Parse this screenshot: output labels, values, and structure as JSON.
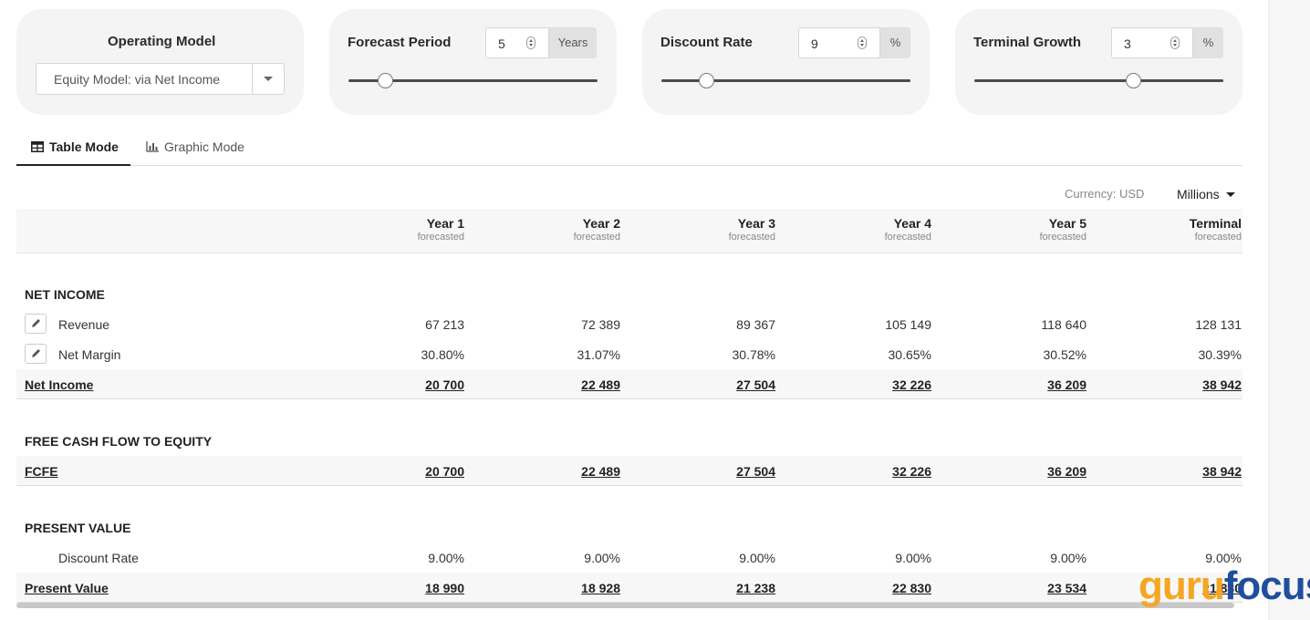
{
  "controls": {
    "operating_model": {
      "title": "Operating Model",
      "value": "Equity Model: via Net Income"
    },
    "forecast_period": {
      "title": "Forecast Period",
      "value": "5",
      "unit": "Years",
      "slider_fraction": 0.15
    },
    "discount_rate": {
      "title": "Discount Rate",
      "value": "9",
      "unit": "%",
      "slider_fraction": 0.18
    },
    "terminal_growth": {
      "title": "Terminal Growth",
      "value": "3",
      "unit": "%",
      "slider_fraction": 0.64
    }
  },
  "tabs": [
    {
      "label": "Table Mode",
      "icon": "table-icon",
      "active": true
    },
    {
      "label": "Graphic Mode",
      "icon": "bar-chart-icon",
      "active": false
    }
  ],
  "currency_label": "Currency: USD",
  "units_selected": "Millions",
  "columns": [
    {
      "label": "Year 1",
      "sub": "forecasted"
    },
    {
      "label": "Year 2",
      "sub": "forecasted"
    },
    {
      "label": "Year 3",
      "sub": "forecasted"
    },
    {
      "label": "Year 4",
      "sub": "forecasted"
    },
    {
      "label": "Year 5",
      "sub": "forecasted"
    },
    {
      "label": "Terminal",
      "sub": "forecasted"
    }
  ],
  "sections": {
    "net_income": {
      "title": "NET INCOME",
      "rows": [
        {
          "label": "Revenue",
          "values": [
            "67 213",
            "72 389",
            "89 367",
            "105 149",
            "118 640",
            "128 131"
          ]
        },
        {
          "label": "Net Margin",
          "values": [
            "30.80%",
            "31.07%",
            "30.78%",
            "30.65%",
            "30.52%",
            "30.39%"
          ]
        }
      ],
      "total": {
        "label": "Net Income",
        "values": [
          "20 700",
          "22 489",
          "27 504",
          "32 226",
          "36 209",
          "38 942"
        ]
      }
    },
    "fcfe": {
      "title": "FREE CASH FLOW TO EQUITY",
      "total": {
        "label": "FCFE",
        "values": [
          "20 700",
          "22 489",
          "27 504",
          "32 226",
          "36 209",
          "38 942"
        ]
      }
    },
    "present_value": {
      "title": "PRESENT VALUE",
      "rows": [
        {
          "label": "Discount Rate",
          "values": [
            "9.00%",
            "9.00%",
            "9.00%",
            "9.00%",
            "9.00%",
            "9.00%"
          ]
        }
      ],
      "total": {
        "label": "Present Value",
        "values": [
          "18 990",
          "18 928",
          "21 238",
          "22 830",
          "23 534",
          "21 830"
        ]
      }
    }
  },
  "watermark": {
    "part1": "guru",
    "part2": "focus"
  },
  "colors": {
    "brand_orange": "#f5a623",
    "brand_blue": "#1f4e9c"
  }
}
